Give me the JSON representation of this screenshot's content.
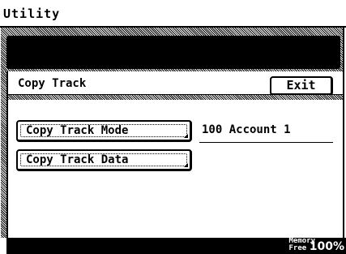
{
  "header": {
    "title": "Utility"
  },
  "panel": {
    "title": "Copy Track",
    "exit_label": "Exit",
    "buttons": [
      {
        "label": "Copy Track Mode",
        "value": "100 Account 1"
      },
      {
        "label": "Copy Track Data"
      }
    ]
  },
  "status": {
    "memory_label_line1": "Memory",
    "memory_label_line2": "Free",
    "memory_value": "100%"
  },
  "colors": {
    "foreground": "#000000",
    "background": "#ffffff"
  }
}
